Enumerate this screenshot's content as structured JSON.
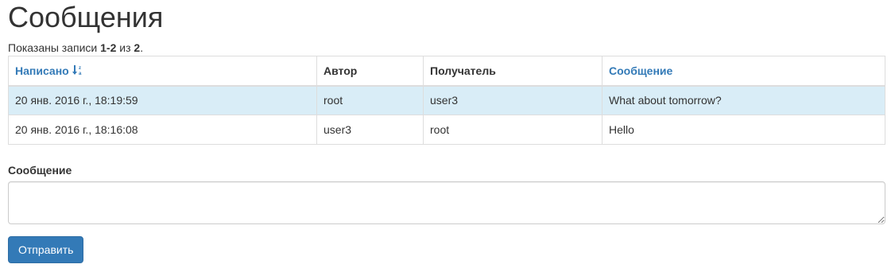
{
  "page": {
    "title": "Сообщения"
  },
  "summary": {
    "prefix": "Показаны записи ",
    "range": "1-2",
    "of": " из ",
    "total": "2",
    "suffix": "."
  },
  "table": {
    "columns": {
      "written": "Написано",
      "author": "Автор",
      "recipient": "Получатель",
      "message": "Сообщение"
    },
    "sort_icon": "sort-alpha-desc-icon",
    "rows": [
      {
        "written": "20 янв. 2016 г., 18:19:59",
        "author": "root",
        "recipient": "user3",
        "message": "What about tomorrow?"
      },
      {
        "written": "20 янв. 2016 г., 18:16:08",
        "author": "user3",
        "recipient": "root",
        "message": "Hello"
      }
    ]
  },
  "form": {
    "message_label": "Сообщение",
    "message_value": "",
    "submit_label": "Отправить"
  },
  "colors": {
    "link": "#337ab7",
    "active_row": "#d9edf7",
    "primary_button": "#337ab7"
  }
}
